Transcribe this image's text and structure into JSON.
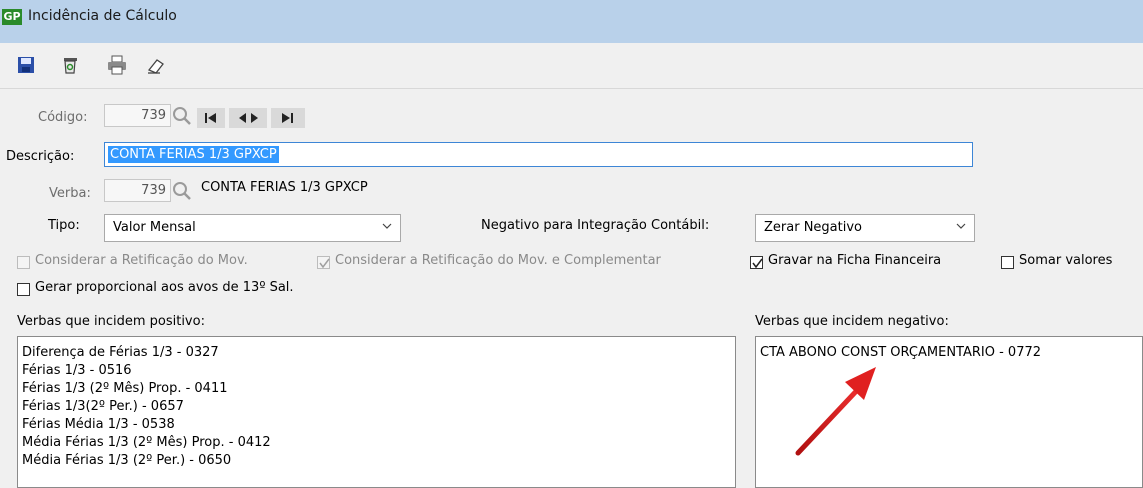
{
  "window": {
    "app_badge": "GP",
    "title": "Incidência de Cálculo"
  },
  "toolbar": {
    "icons": [
      "save-icon",
      "delete-icon",
      "print-icon",
      "eraser-icon"
    ]
  },
  "form": {
    "codigo_label": "Código:",
    "codigo_value": "739",
    "descricao_label": "Descrição:",
    "descricao_value": "CONTA FERIAS 1/3 GPXCP",
    "verba_label": "Verba:",
    "verba_value": "739",
    "verba_desc": "CONTA FERIAS 1/3 GPXCP",
    "tipo_label": "Tipo:",
    "tipo_value": "Valor Mensal",
    "negativo_label": "Negativo para Integração Contábil:",
    "negativo_value": "Zerar Negativo"
  },
  "checkboxes": [
    {
      "label": "Considerar a Retificação do Mov.",
      "checked": false,
      "enabled": false
    },
    {
      "label": "Considerar a Retificação do Mov. e Complementar",
      "checked": true,
      "enabled": false
    },
    {
      "label": "Gravar na Ficha Financeira",
      "checked": true,
      "enabled": true
    },
    {
      "label": "Somar valores",
      "checked": false,
      "enabled": true
    },
    {
      "label": "Gerar proporcional aos avos de 13º Sal.",
      "checked": false,
      "enabled": true
    }
  ],
  "lists": {
    "positive_label": "Verbas que incidem positivo:",
    "positive_items": [
      "Diferença de Férias 1/3 - 0327",
      "Férias 1/3 - 0516",
      "Férias 1/3 (2º Mês) Prop. - 0411",
      "Férias 1/3(2º Per.) - 0657",
      "Férias Média 1/3 - 0538",
      "Média Férias 1/3 (2º Mês) Prop. - 0412",
      "Média Férias 1/3 (2º Per.) - 0650"
    ],
    "negative_label": "Verbas que incidem negativo:",
    "negative_items": [
      "CTA ABONO CONST ORÇAMENTARIO - 0772"
    ]
  },
  "colors": {
    "titlebar": "#b9d1ea",
    "selection": "#3399ff",
    "arrow": "#e02020"
  }
}
